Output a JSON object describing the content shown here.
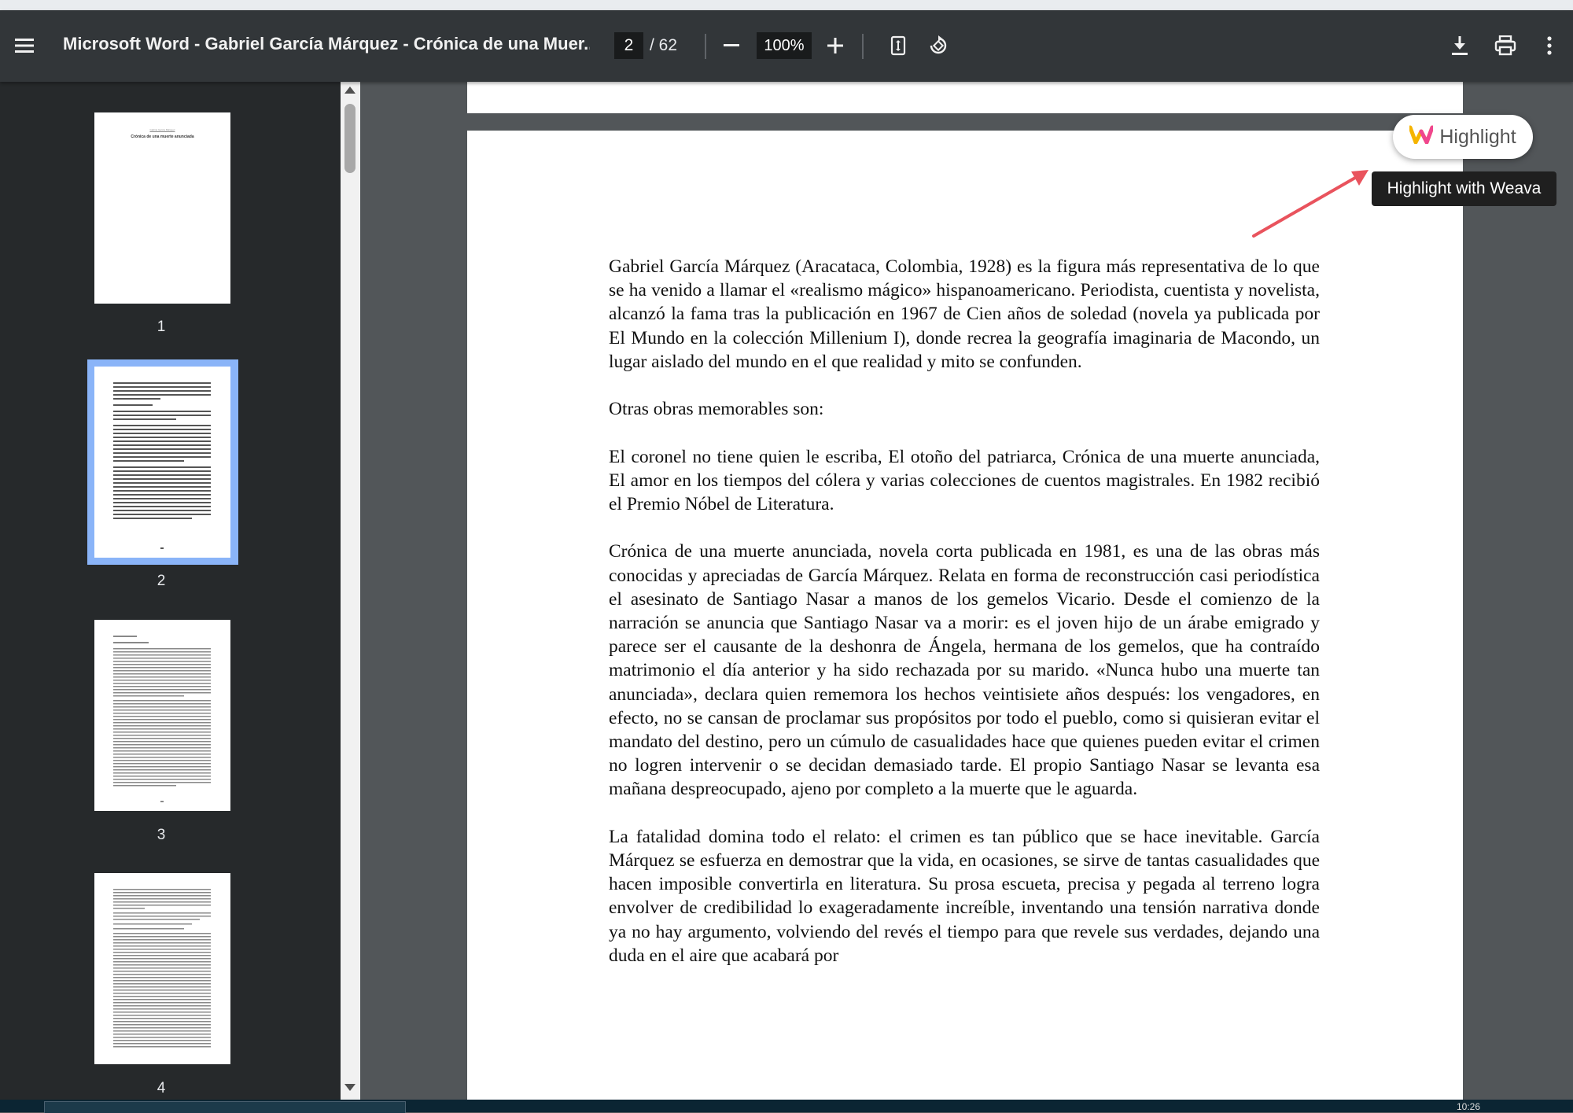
{
  "toolbar": {
    "title": "Microsoft Word - Gabriel García Márquez - Crónica de una Muer...",
    "page_current": "2",
    "page_total": "/ 62",
    "zoom": "100%"
  },
  "thumbnails": [
    {
      "num": "1",
      "title_line1": "Gabriel García Márquez",
      "title_line2": "Crónica de una muerte anunciada"
    },
    {
      "num": "2"
    },
    {
      "num": "3"
    },
    {
      "num": "4"
    }
  ],
  "document": {
    "paragraphs": [
      "Gabriel García Márquez (Aracataca, Colombia, 1928) es la figura más representativa de lo que se ha venido a llamar el «realismo mágico» hispanoamericano. Periodista, cuentista y novelista, alcanzó la fama tras la publicación en 1967 de Cien años de soledad (novela ya publicada por El Mundo en la colección Millenium I), donde recrea la geografía imaginaria de Macondo, un lugar aislado del mundo en el que realidad y mito se confunden.",
      "Otras obras memorables son:",
      "El coronel no tiene quien le escriba, El otoño del patriarca, Crónica de una muerte anunciada, El amor en los tiempos del cólera y varias colecciones de cuentos magistrales. En 1982 recibió el Premio Nóbel de Literatura.",
      "Crónica de una muerte anunciada, novela corta publicada en 1981, es una de las obras más conocidas y apreciadas de García Márquez. Relata en forma de reconstrucción casi periodística el asesinato de Santiago Nasar a manos de los gemelos Vicario. Desde el comienzo de la narración se anuncia que Santiago Nasar va a morir: es el joven hijo de un árabe emigrado y parece ser el causante de la deshonra de Ángela, hermana de los gemelos, que ha contraído matrimonio el día anterior y ha sido rechazada por su marido. «Nunca hubo una muerte tan anunciada», declara quien rememora los hechos veintisiete años después: los vengadores, en efecto, no se cansan de proclamar sus propósitos por todo el pueblo, como si quisieran evitar el mandato del destino, pero un cúmulo de casualidades hace que quienes pueden evitar el crimen no logren intervenir o se decidan demasiado tarde. El propio Santiago Nasar se levanta esa mañana despreocupado, ajeno por completo a la muerte que le aguarda.",
      "La fatalidad domina todo el relato: el crimen es tan público que se hace inevitable. García Márquez se esfuerza en demostrar que la vida, en ocasiones, se sirve de tantas casualidades que hacen imposible convertirla en literatura. Su prosa escueta, precisa y pegada al terreno logra envolver de credibilidad lo exageradamente increíble, inventando una tensión narrativa donde ya no hay argumento, volviendo del revés el tiempo para que revele sus verdades, dejando una duda en el aire que acabará por"
    ]
  },
  "weava": {
    "button_label": "Highlight",
    "tooltip": "Highlight with Weava"
  },
  "taskbar": {
    "clock": "10:26"
  },
  "colors": {
    "toolbar_bg": "#323639",
    "sidebar_bg": "#26292b",
    "viewer_bg": "#525659",
    "selected_thumb": "#8ab4f8",
    "arrow": "#e9535d"
  }
}
